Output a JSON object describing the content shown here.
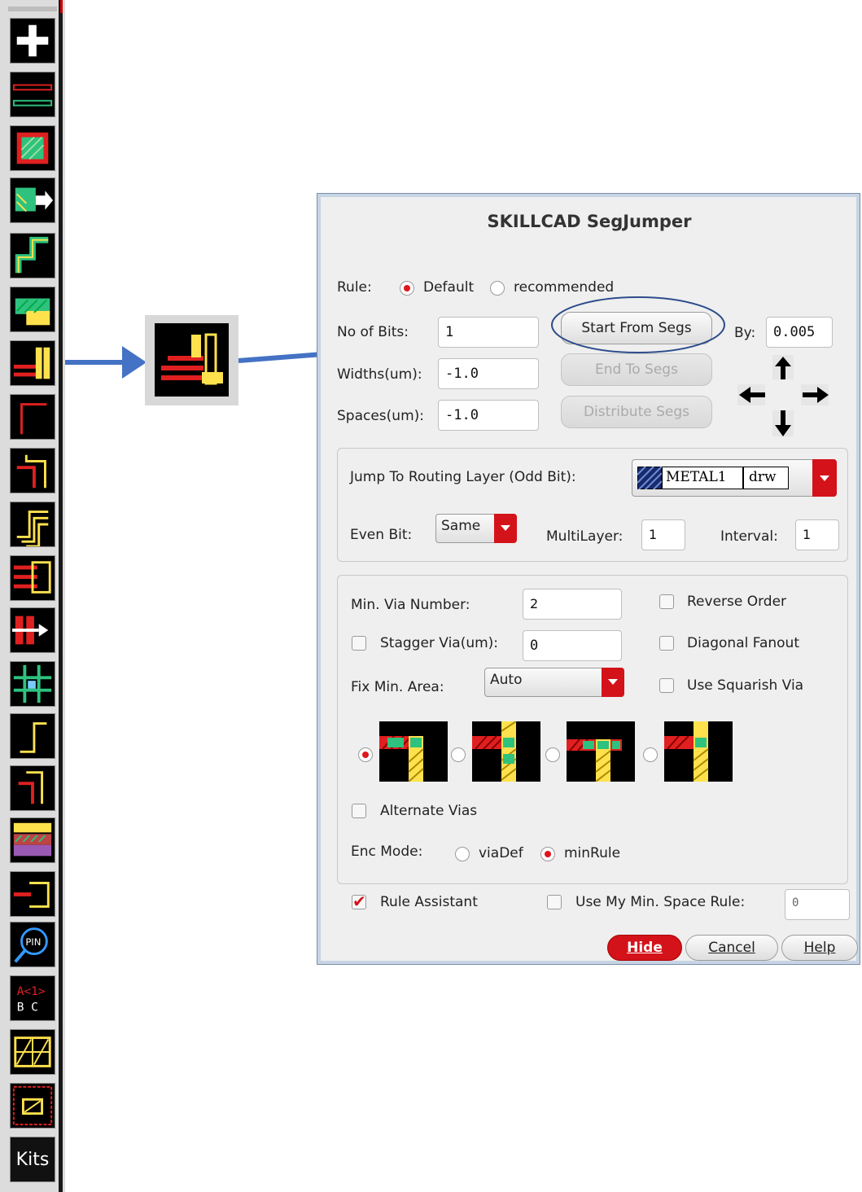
{
  "toolbar": {
    "items": [
      "plus-icon",
      "bus-lines-icon",
      "via-square-icon",
      "move-shape-icon",
      "step-route-icon",
      "stack-shapes-icon",
      "seg-jumper-icon",
      "step-single-icon",
      "double-step-icon",
      "triple-step-icon",
      "bus-extend-icon",
      "push-bits-icon",
      "grid-cross-icon",
      "step-small-icon",
      "step-red-icon",
      "layer-fill-icon",
      "fork-icon",
      "pin-search-icon",
      "label-bus-icon",
      "hatched-grid-icon",
      "dot-grid-icon"
    ],
    "kits_label": "Kits"
  },
  "dialog": {
    "title": "SKILLCAD SegJumper",
    "rule_label": "Rule:",
    "rule_options": [
      "Default",
      "recommended"
    ],
    "rule_selected": "Default",
    "bits_label": "No of Bits:",
    "bits_value": "1",
    "widths_label": "Widths(um):",
    "widths_value": "-1.0",
    "spaces_label": "Spaces(um):",
    "spaces_value": "-1.0",
    "start_button": "Start From Segs",
    "end_button": "End To Segs",
    "distribute_button": "Distribute Segs",
    "by_label": "By:",
    "by_value": "0.005",
    "jump_label": "Jump To Routing Layer (Odd Bit):",
    "layer_name": "METAL1",
    "layer_purpose": "drw",
    "even_bit_label": "Even Bit:",
    "even_bit_value": "Same",
    "multilayer_label": "MultiLayer:",
    "multilayer_value": "1",
    "interval_label": "Interval:",
    "interval_value": "1",
    "min_via_label": "Min. Via Number:",
    "min_via_value": "2",
    "stagger_label": "Stagger Via(um):",
    "stagger_value": "0",
    "fix_area_label": "Fix Min. Area:",
    "fix_area_value": "Auto",
    "reverse_order_label": "Reverse Order",
    "diagonal_fanout_label": "Diagonal Fanout",
    "squarish_via_label": "Use Squarish Via",
    "alternate_vias_label": "Alternate Vias",
    "enc_mode_label": "Enc Mode:",
    "enc_options": [
      "viaDef",
      "minRule"
    ],
    "enc_selected": "minRule",
    "rule_assistant_label": "Rule Assistant",
    "min_space_label": "Use My Min. Space Rule:",
    "min_space_value": "0",
    "hide_button": "Hide",
    "cancel_button": "Cancel",
    "help_button": "Help"
  },
  "colors": {
    "accent_red": "#d4121a",
    "arrow_blue": "#4472c4",
    "dialog_border": "#7a8fa8"
  }
}
